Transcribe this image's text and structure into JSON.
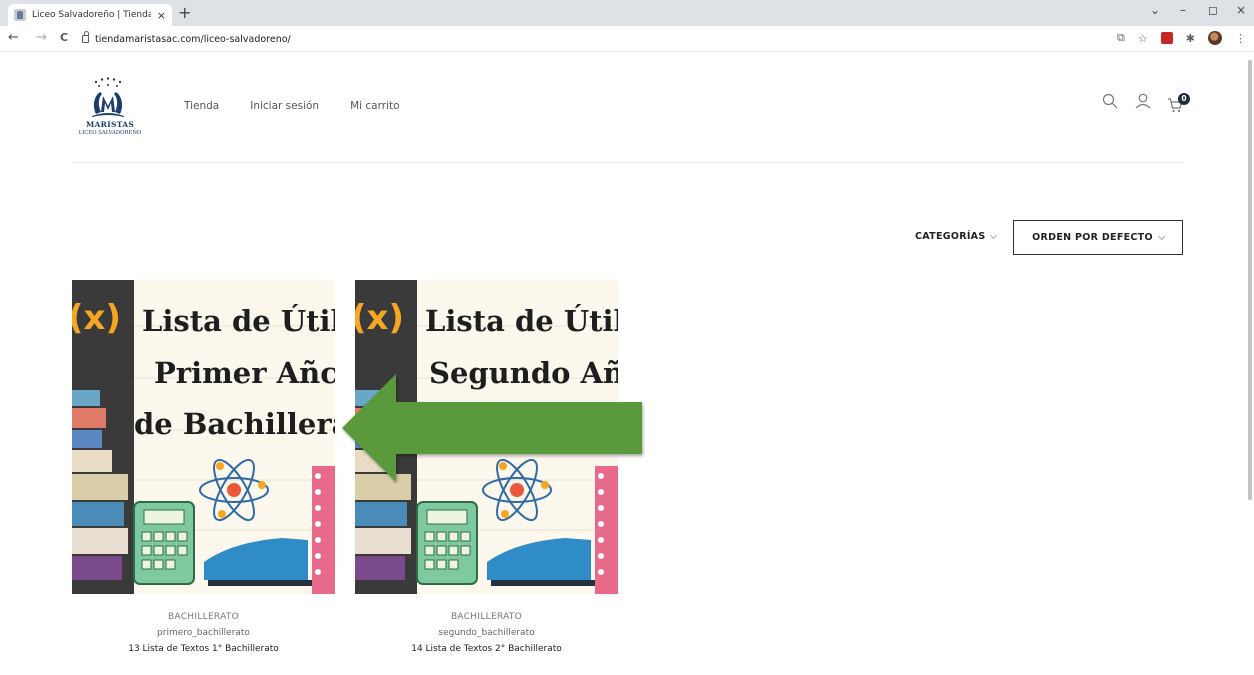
{
  "browser": {
    "tab_title": "Liceo Salvadoreño | TiendaMarist",
    "tab_close": "×",
    "new_tab": "+",
    "url": "tiendamaristasac.com/liceo-salvadoreno/",
    "back": "←",
    "forward": "→",
    "reload": "C",
    "min": "–",
    "restore": "◻",
    "close": "×",
    "menu": "⋮"
  },
  "header": {
    "logo_line1": "MARISTAS",
    "logo_line2": "LICEO SALVADOREÑO",
    "nav": [
      "Tienda",
      "Iniciar sesión",
      "Mi carrito"
    ],
    "cart_count": "0"
  },
  "filters": {
    "categories_label": "CATEGORÍAS",
    "order_label": "ORDEN POR DEFECTO"
  },
  "products": [
    {
      "image_line1": "Lista de Útil",
      "image_line2": "Primer Añc",
      "image_line3": "de Bachillera",
      "category": "BACHILLERATO",
      "slug": "primero_bachillerato",
      "name": "13 Lista de Textos 1° Bachillerato"
    },
    {
      "image_line1": "Lista de Útil",
      "image_line2": "Segundo Añ",
      "image_line3": "",
      "category": "BACHILLERATO",
      "slug": "segundo_bachillerato",
      "name": "14 Lista de Textos 2° Bachillerato"
    }
  ],
  "colors": {
    "arrow": "#5a9a3c",
    "chalkboard": "#3a3a3a",
    "accent_orange": "#f5a623",
    "cart_badge": "#1c2d44"
  }
}
